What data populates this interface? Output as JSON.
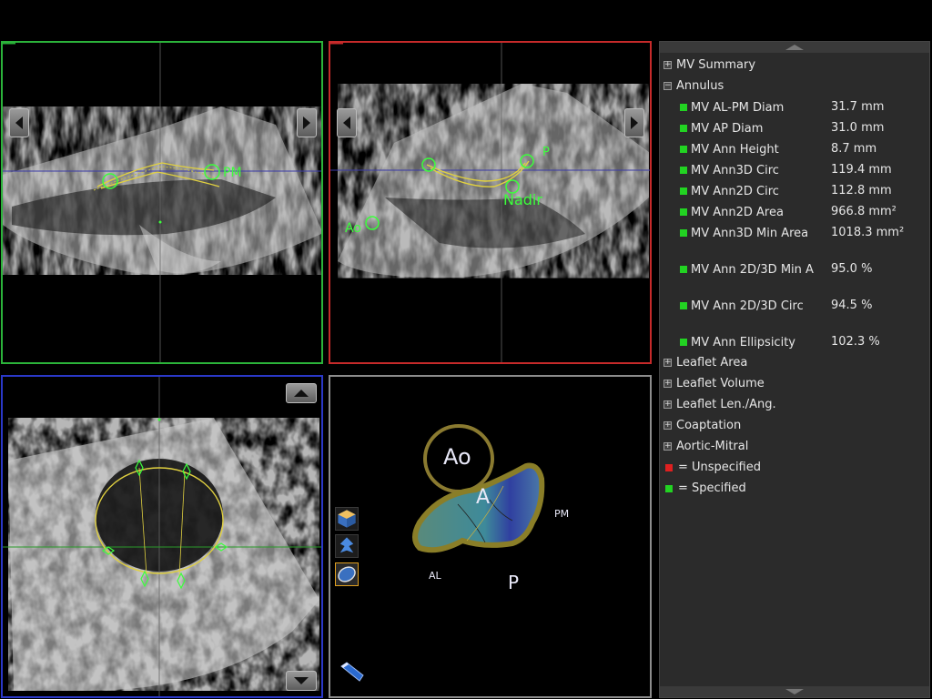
{
  "viewports": {
    "green": {
      "labels": {
        "pm": "PM"
      }
    },
    "red": {
      "labels": {
        "p": "P",
        "nadir": "Nadir",
        "ao": "Ao"
      }
    },
    "gray": {
      "labels": {
        "ao": "Ao",
        "a": "A",
        "pm": "PM",
        "al": "AL",
        "p": "P"
      }
    }
  },
  "panel": {
    "sections": [
      {
        "label": "MV Summary",
        "expanded": false
      },
      {
        "label": "Annulus",
        "expanded": true
      }
    ],
    "measurements": [
      {
        "name": "MV AL-PM Diam",
        "value": "31.7 mm"
      },
      {
        "name": "MV AP Diam",
        "value": "31.0 mm"
      },
      {
        "name": "MV Ann Height",
        "value": "8.7 mm"
      },
      {
        "name": "MV Ann3D Circ",
        "value": "119.4 mm"
      },
      {
        "name": "MV Ann2D Circ",
        "value": "112.8 mm"
      },
      {
        "name": "MV Ann2D Area",
        "value": "966.8 mm²"
      },
      {
        "name": "MV Ann3D Min Area",
        "value": "1018.3 mm²"
      },
      {
        "name": "MV Ann 2D/3D Min A",
        "value": "95.0 %"
      },
      {
        "name": "MV Ann 2D/3D Circ",
        "value": "94.5 %"
      },
      {
        "name": "MV Ann Ellipsicity",
        "value": "102.3 %"
      }
    ],
    "more_sections": [
      {
        "label": "Leaflet Area"
      },
      {
        "label": "Leaflet Volume"
      },
      {
        "label": "Leaflet Len./Ang."
      },
      {
        "label": "Coaptation"
      },
      {
        "label": "Aortic-Mitral"
      }
    ],
    "legend": [
      {
        "label": "= Unspecified",
        "color": "#e02020"
      },
      {
        "label": "= Specified",
        "color": "#22d322"
      }
    ]
  },
  "colors": {
    "green_frame": "#2bb33a",
    "red_frame": "#c62a2a",
    "blue_frame": "#2a38c8",
    "gray_frame": "#8c8c8c",
    "annotation": "#3cff3c",
    "trace": "#e0d040"
  },
  "icons": {
    "nav_left": "chevron-left-icon",
    "nav_right": "chevron-right-icon",
    "tool_cube": "cube-icon",
    "tool_leaflet": "leaflet-icon",
    "tool_valve": "valve-icon",
    "probe": "probe-icon"
  }
}
